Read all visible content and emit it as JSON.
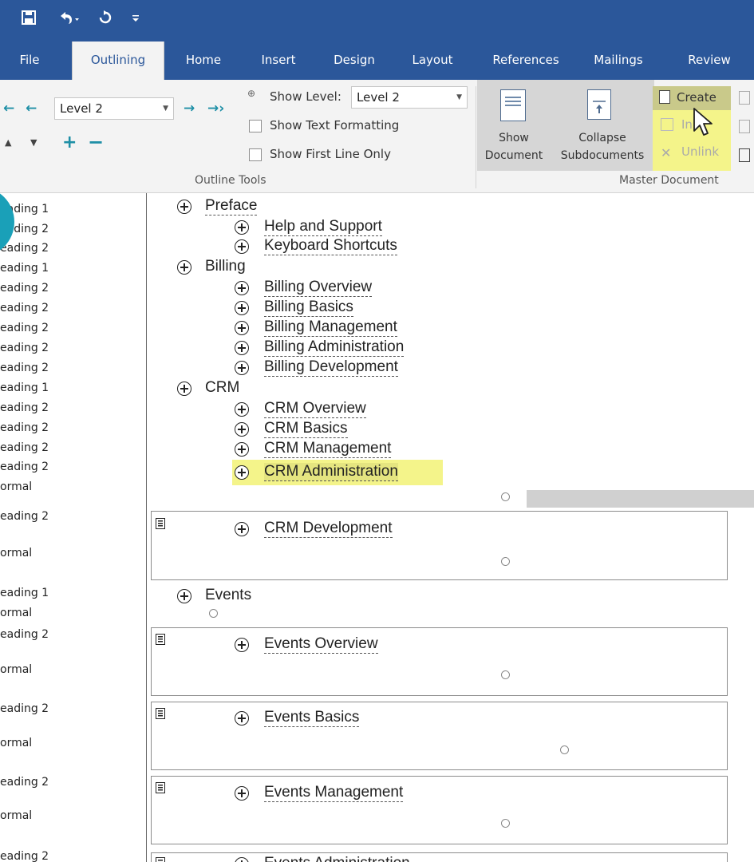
{
  "qat": {
    "save_icon": "save-icon",
    "undo_icon": "undo-icon",
    "redo_icon": "redo-icon",
    "customize_icon": "customize-qat-icon"
  },
  "tabs": [
    "File",
    "Outlining",
    "Home",
    "Insert",
    "Design",
    "Layout",
    "References",
    "Mailings",
    "Review"
  ],
  "active_tab": "Outlining",
  "ribbon": {
    "level_combo_value": "Level 2",
    "show_level_label": "Show Level:",
    "show_level_value": "Level 2",
    "show_text_formatting": "Show Text Formatting",
    "show_first_line_only": "Show First Line Only",
    "outline_tools_label": "Outline Tools",
    "show_document_line1": "Show",
    "show_document_line2": "Document",
    "collapse_line1": "Collapse",
    "collapse_line2": "Subdocuments",
    "create": "Create",
    "insert": "In",
    "unlink": "Unlink",
    "master_document_label": "Master Document"
  },
  "styles": [
    "eading 1",
    "eading 2",
    "eading 2",
    "eading 1",
    "eading 2",
    "eading 2",
    "eading 2",
    "eading 2",
    "eading 2",
    "eading 1",
    "eading 2",
    "eading 2",
    "eading 2",
    "eading 2",
    "ormal",
    "eading 2",
    "ormal",
    "eading 1",
    "ormal",
    "eading 2",
    "ormal",
    "eading 2",
    "ormal",
    "eading 2",
    "ormal",
    "eading 2"
  ],
  "outline": {
    "preface": "Preface",
    "help": "Help and Support",
    "keyboard": "Keyboard Shortcuts",
    "billing": "Billing",
    "billing_overview": "Billing Overview",
    "billing_basics": "Billing Basics",
    "billing_management": "Billing Management",
    "billing_administration": "Billing Administration",
    "billing_development": "Billing Development",
    "crm": "CRM",
    "crm_overview": "CRM Overview",
    "crm_basics": "CRM Basics",
    "crm_management": "CRM Management",
    "crm_administration": "CRM Administration",
    "crm_development": "CRM Development",
    "events": "Events",
    "events_overview": "Events Overview",
    "events_basics": "Events Basics",
    "events_management": "Events Management",
    "events_administration": "Events Administration"
  },
  "colors": {
    "titlebar": "#2b579a",
    "highlight": "#f4f48a",
    "ribbon": "#f3f3f3",
    "arrow": "#1e8fa6"
  }
}
